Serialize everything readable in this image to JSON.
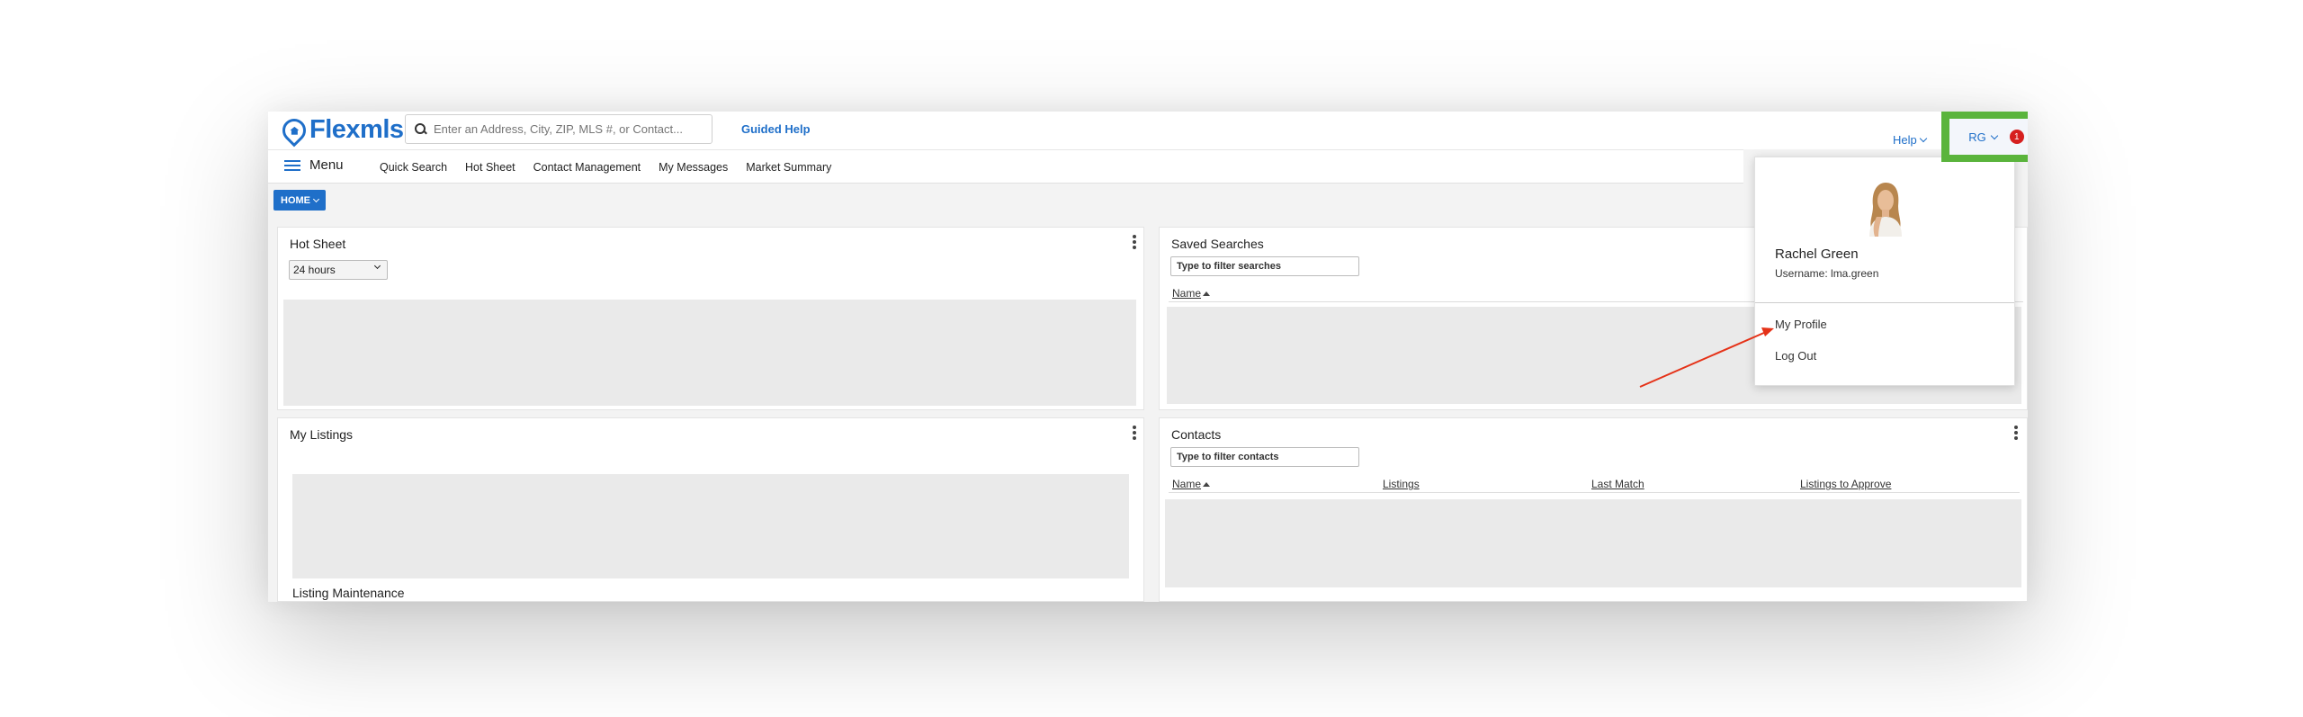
{
  "header": {
    "logo_text": "Flexmls",
    "search_placeholder": "Enter an Address, City, ZIP, MLS #, or Contact...",
    "guided_help": "Guided Help",
    "help": "Help",
    "user_initials": "RG",
    "notification_count": "1",
    "highlight_color": "#5ab43c"
  },
  "nav": {
    "menu_label": "Menu",
    "items": [
      "Quick Search",
      "Hot Sheet",
      "Contact Management",
      "My Messages",
      "Market Summary"
    ]
  },
  "home_button": "HOME",
  "panels": {
    "hot_sheet": {
      "title": "Hot Sheet",
      "selected": "24 hours"
    },
    "saved_searches": {
      "title": "Saved Searches",
      "filter_placeholder": "Type to filter searches",
      "col_name": "Name"
    },
    "my_listings": {
      "title": "My Listings",
      "footer": "Listing Maintenance"
    },
    "contacts": {
      "title": "Contacts",
      "filter_placeholder": "Type to filter contacts",
      "columns": [
        "Name",
        "Listings",
        "Last Match",
        "Listings to Approve"
      ]
    }
  },
  "user_menu": {
    "name": "Rachel Green",
    "username": "Username: lma.green",
    "items": [
      "My Profile",
      "Log Out"
    ]
  },
  "annotation": {
    "arrow_color": "#e53218"
  }
}
